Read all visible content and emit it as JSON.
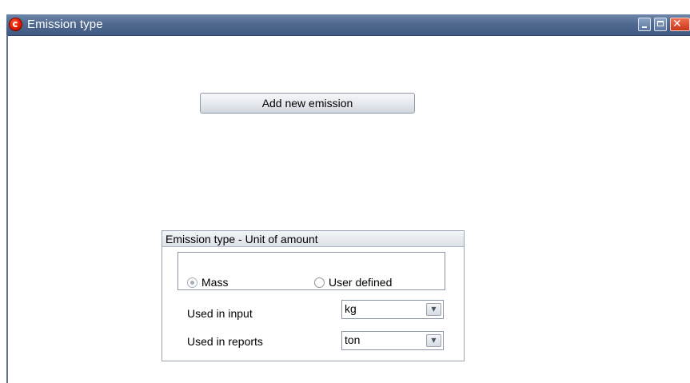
{
  "window": {
    "title": "Emission type"
  },
  "toolbar": {
    "add_label": "Add new emission"
  },
  "panel": {
    "header": "Emission type  - Unit of amount",
    "radios": [
      {
        "label": "Mass",
        "checked": true
      },
      {
        "label": "User defined",
        "checked": false
      }
    ],
    "rows": [
      {
        "label": "Used in input",
        "value": "kg"
      },
      {
        "label": "Used in reports",
        "value": "ton"
      }
    ]
  },
  "icons": {
    "dropdown_arrow": "chevron-down-icon"
  }
}
